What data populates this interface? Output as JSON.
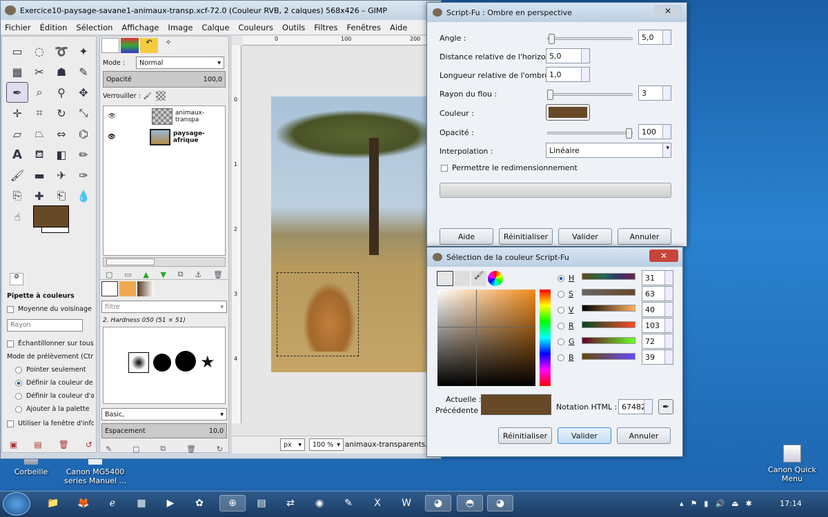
{
  "desktop": {
    "icons": [
      {
        "label": "Corbeille"
      },
      {
        "label": "Canon MG5400 series Manuel ..."
      },
      {
        "label": "Canon Quick Menu"
      }
    ]
  },
  "gimp": {
    "title": "Exercice10-paysage-savane1-animaux-transp.xcf-72.0 (Couleur RVB, 2 calques) 568x426 – GIMP",
    "menu": [
      "Fichier",
      "Édition",
      "Sélection",
      "Affichage",
      "Image",
      "Calque",
      "Couleurs",
      "Outils",
      "Filtres",
      "Fenêtres",
      "Aide"
    ],
    "toolOptions": {
      "title": "Pipette à couleurs",
      "average": "Moyenne du voisinage",
      "radius": "Rayon",
      "sampleMerged": "Échantillonner sur tous le",
      "modeLabel": "Mode de prélèvement (Ctrl)",
      "modes": [
        "Pointer seulement",
        "Définir la couleur de p",
        "Définir la couleur d'arr",
        "Ajouter à la palette"
      ],
      "useInfo": "Utiliser la fenêtre d'inform"
    },
    "layers": {
      "modeLabel": "Mode :",
      "mode": "Normal",
      "opacityLabel": "Opacité",
      "opacity": "100,0",
      "lockLabel": "Verrouiller :",
      "items": [
        {
          "name": "animaux-transpa"
        },
        {
          "name": "paysage-afrique"
        }
      ]
    },
    "brushes": {
      "filter": "filtre",
      "current": "2. Hardness 050 (51 × 51)",
      "tag": "Basic,",
      "spacingLabel": "Espacement",
      "spacing": "10,0"
    },
    "rulers": {
      "h": [
        "0",
        "100",
        "200"
      ],
      "v": [
        "1",
        "2",
        "3",
        "4",
        "0"
      ]
    },
    "status": {
      "unit": "px",
      "zoom": "100 %",
      "name": "animaux-transparents.p"
    }
  },
  "perspective": {
    "title": "Script-Fu : Ombre en perspective",
    "close": "✕",
    "angle": {
      "label": "Angle :",
      "value": "5,0"
    },
    "horizon": {
      "label": "Distance relative de l'horizon :",
      "value": "5,0"
    },
    "length": {
      "label": "Longueur relative de l'ombre :",
      "value": "1,0"
    },
    "blur": {
      "label": "Rayon du flou :",
      "value": "3"
    },
    "color": {
      "label": "Couleur :",
      "value": "#674827"
    },
    "opacity": {
      "label": "Opacité :",
      "value": "100"
    },
    "interp": {
      "label": "Interpolation :",
      "value": "Linéaire"
    },
    "resize": "Permettre le redimensionnement",
    "buttons": {
      "help": "Aide",
      "reset": "Réinitialiser",
      "ok": "Valider",
      "cancel": "Annuler"
    }
  },
  "colorsel": {
    "title": "Sélection de la couleur Script-Fu",
    "close": "✕",
    "channels": [
      {
        "name": "H",
        "value": "31"
      },
      {
        "name": "S",
        "value": "63"
      },
      {
        "name": "V",
        "value": "40"
      },
      {
        "name": "R",
        "value": "103"
      },
      {
        "name": "G",
        "value": "72"
      },
      {
        "name": "B",
        "value": "39"
      }
    ],
    "current": "Actuelle :",
    "previous": "Précédente :",
    "htmlLabel": "Notation HTML :",
    "html": "674827",
    "swatch": "#674827",
    "buttons": {
      "reset": "Réinitialiser",
      "ok": "Valider",
      "cancel": "Annuler"
    }
  },
  "taskbar": {
    "time": "17:14"
  }
}
